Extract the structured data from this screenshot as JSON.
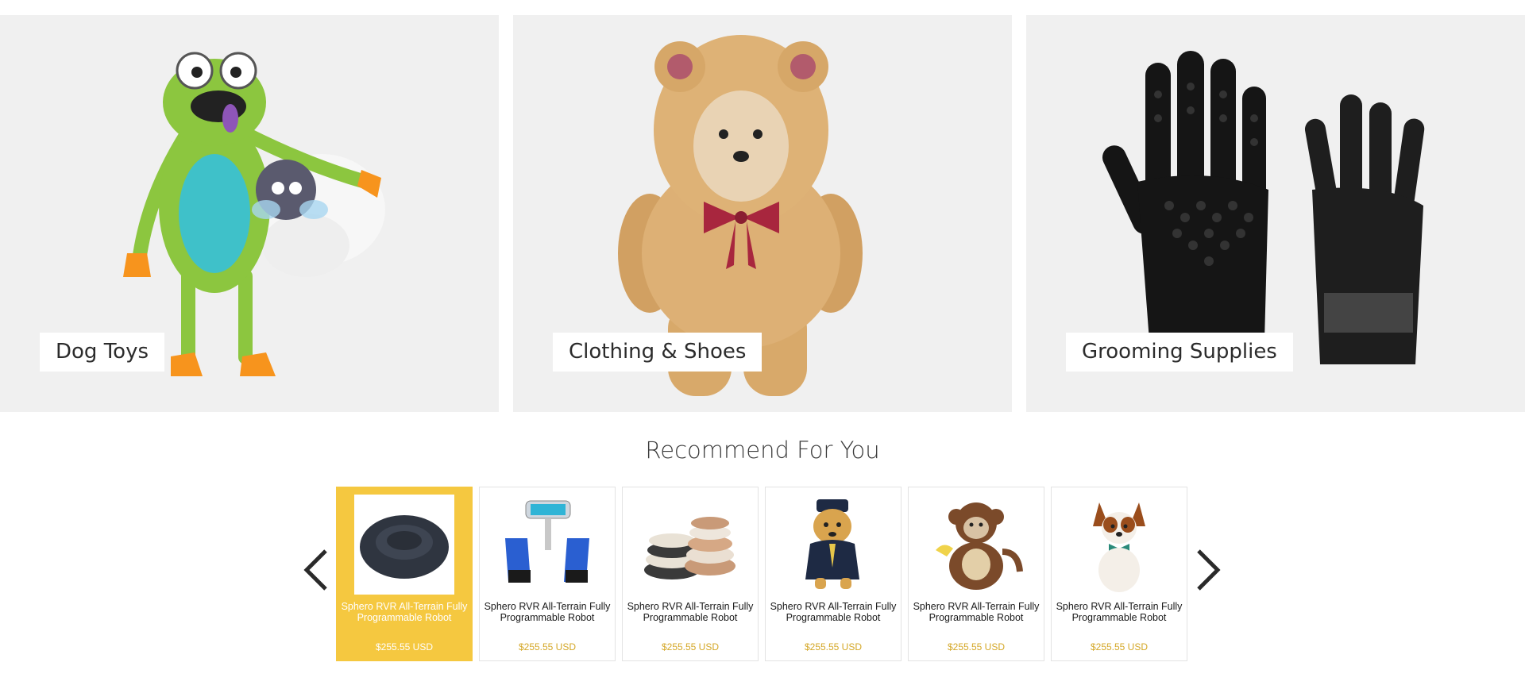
{
  "categories": [
    {
      "label": "Dog Toys",
      "icon": "frog-plush-toy-image"
    },
    {
      "label": "Clothing & Shoes",
      "icon": "teddy-bear-costume-dog-image"
    },
    {
      "label": "Grooming Supplies",
      "icon": "grooming-gloves-image"
    }
  ],
  "recommend": {
    "title": "Recommend For You",
    "prev_icon": "chevron-left-icon",
    "next_icon": "chevron-right-icon",
    "products": [
      {
        "name": "Sphero RVR All-Terrain Fully Programmable Robot",
        "price": "$255.55 USD",
        "image": "round-pet-bed",
        "active": true
      },
      {
        "name": "Sphero RVR All-Terrain Fully Programmable Robot",
        "price": "$255.55 USD",
        "image": "lint-roller-and-gloves",
        "active": false
      },
      {
        "name": "Sphero RVR All-Terrain Fully Programmable Robot",
        "price": "$255.55 USD",
        "image": "stacked-pet-mats",
        "active": false
      },
      {
        "name": "Sphero RVR All-Terrain Fully Programmable Robot",
        "price": "$255.55 USD",
        "image": "dog-in-sailor-costume",
        "active": false
      },
      {
        "name": "Sphero RVR All-Terrain Fully Programmable Robot",
        "price": "$255.55 USD",
        "image": "dog-in-monkey-costume",
        "active": false
      },
      {
        "name": "Sphero RVR All-Terrain Fully Programmable Robot",
        "price": "$255.55 USD",
        "image": "papillon-with-bow-tie",
        "active": false
      }
    ]
  },
  "colors": {
    "banner_bg": "#f0f0f0",
    "active_card": "#f5c840",
    "price": "#d4a726"
  }
}
